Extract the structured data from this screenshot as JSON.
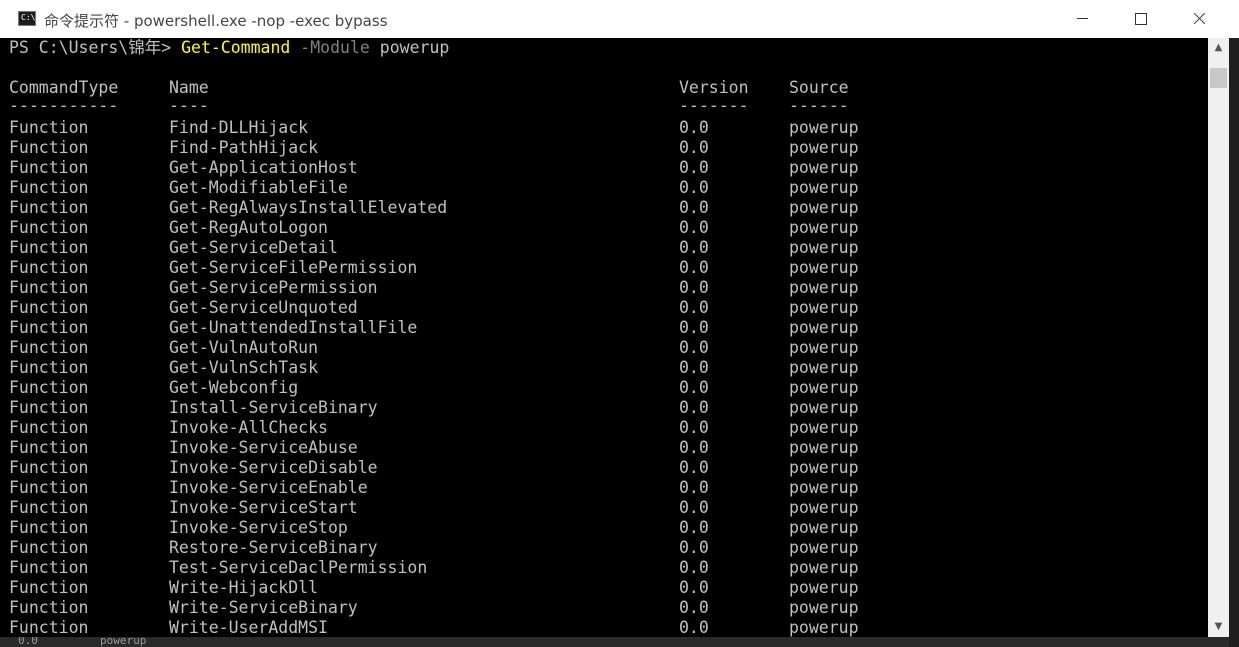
{
  "window": {
    "title": "命令提示符 - powershell.exe  -nop -exec bypass",
    "icon": "console-app-icon",
    "icon_glyph": "C:\\."
  },
  "prompt": {
    "path": "PS C:\\Users\\锦年> ",
    "command": "Get-Command",
    "param": " -Module",
    "arg": " powerup"
  },
  "table": {
    "headers": [
      "CommandType",
      "Name",
      "Version",
      "Source"
    ],
    "underlines": [
      "-----------",
      "----",
      "-------",
      "------"
    ],
    "rows": [
      [
        "Function",
        "Find-DLLHijack",
        "0.0",
        "powerup"
      ],
      [
        "Function",
        "Find-PathHijack",
        "0.0",
        "powerup"
      ],
      [
        "Function",
        "Get-ApplicationHost",
        "0.0",
        "powerup"
      ],
      [
        "Function",
        "Get-ModifiableFile",
        "0.0",
        "powerup"
      ],
      [
        "Function",
        "Get-RegAlwaysInstallElevated",
        "0.0",
        "powerup"
      ],
      [
        "Function",
        "Get-RegAutoLogon",
        "0.0",
        "powerup"
      ],
      [
        "Function",
        "Get-ServiceDetail",
        "0.0",
        "powerup"
      ],
      [
        "Function",
        "Get-ServiceFilePermission",
        "0.0",
        "powerup"
      ],
      [
        "Function",
        "Get-ServicePermission",
        "0.0",
        "powerup"
      ],
      [
        "Function",
        "Get-ServiceUnquoted",
        "0.0",
        "powerup"
      ],
      [
        "Function",
        "Get-UnattendedInstallFile",
        "0.0",
        "powerup"
      ],
      [
        "Function",
        "Get-VulnAutoRun",
        "0.0",
        "powerup"
      ],
      [
        "Function",
        "Get-VulnSchTask",
        "0.0",
        "powerup"
      ],
      [
        "Function",
        "Get-Webconfig",
        "0.0",
        "powerup"
      ],
      [
        "Function",
        "Install-ServiceBinary",
        "0.0",
        "powerup"
      ],
      [
        "Function",
        "Invoke-AllChecks",
        "0.0",
        "powerup"
      ],
      [
        "Function",
        "Invoke-ServiceAbuse",
        "0.0",
        "powerup"
      ],
      [
        "Function",
        "Invoke-ServiceDisable",
        "0.0",
        "powerup"
      ],
      [
        "Function",
        "Invoke-ServiceEnable",
        "0.0",
        "powerup"
      ],
      [
        "Function",
        "Invoke-ServiceStart",
        "0.0",
        "powerup"
      ],
      [
        "Function",
        "Invoke-ServiceStop",
        "0.0",
        "powerup"
      ],
      [
        "Function",
        "Restore-ServiceBinary",
        "0.0",
        "powerup"
      ],
      [
        "Function",
        "Test-ServiceDaclPermission",
        "0.0",
        "powerup"
      ],
      [
        "Function",
        "Write-HijackDll",
        "0.0",
        "powerup"
      ],
      [
        "Function",
        "Write-ServiceBinary",
        "0.0",
        "powerup"
      ],
      [
        "Function",
        "Write-UserAddMSI",
        "0.0",
        "powerup"
      ]
    ]
  },
  "background_peek": {
    "text1": "0.0",
    "text2": "powerup"
  },
  "colors": {
    "console_bg": "#000000",
    "console_fg": "#c0c0c0",
    "command_color": "#ffff00",
    "param_color": "#808080"
  }
}
